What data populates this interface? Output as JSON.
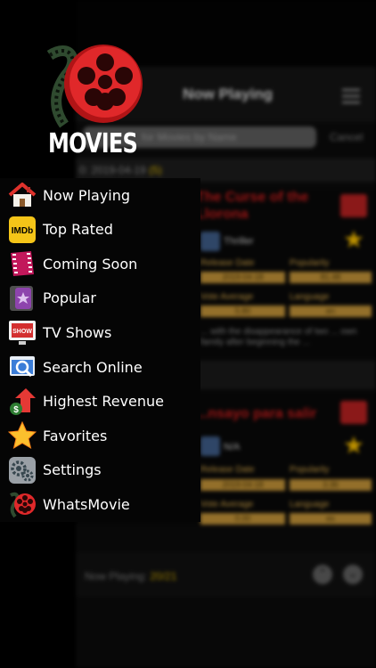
{
  "app": {
    "title": "MOVIES"
  },
  "menu": {
    "items": [
      {
        "label": "Now Playing",
        "icon": "home-icon"
      },
      {
        "label": "Top Rated",
        "icon": "imdb-icon",
        "icon_text": "IMDb"
      },
      {
        "label": "Coming Soon",
        "icon": "film-strip-icon"
      },
      {
        "label": "Popular",
        "icon": "popular-icon"
      },
      {
        "label": "TV Shows",
        "icon": "tv-show-icon",
        "icon_text": "SHOW"
      },
      {
        "label": "Search Online",
        "icon": "search-online-icon"
      },
      {
        "label": "Highest Revenue",
        "icon": "revenue-icon"
      },
      {
        "label": "Favorites",
        "icon": "star-icon"
      },
      {
        "label": "Settings",
        "icon": "settings-icon"
      },
      {
        "label": "WhatsMovie",
        "icon": "whatsmovie-icon"
      }
    ]
  },
  "background": {
    "nav_title": "Now Playing",
    "search_placeholder": "for Movies by Name",
    "cancel_label": "Cancel",
    "date_header": "0: 2019-04-19",
    "date_count": "(5)",
    "cards": [
      {
        "title": "The Curse of the Llorona",
        "genre": "Thriller",
        "release_label": "Release Date",
        "release_value": "2019-04-18",
        "popularity_label": "Popularity",
        "popularity_value": "81.48",
        "vote_label": "Vote Average",
        "vote_value": "5.80",
        "language_label": "Language",
        "language_value": "en",
        "description": "... with the disappearance of two ... own family after beginning the ..."
      },
      {
        "title": "...nsayo para salir",
        "genre": "N/A",
        "release_label": "Release Date",
        "release_value": "2019-04-18",
        "popularity_label": "Popularity",
        "popularity_value": "3.36",
        "vote_label": "Vote Average",
        "vote_value": "0.00",
        "language_label": "Language",
        "language_value": "es"
      }
    ],
    "bottom_label": "Now Playing:",
    "bottom_value": "20/21"
  },
  "colors": {
    "brand_red": "#e0282a",
    "accent_gold": "#bd8f36",
    "count_yellow": "#d8b400"
  }
}
